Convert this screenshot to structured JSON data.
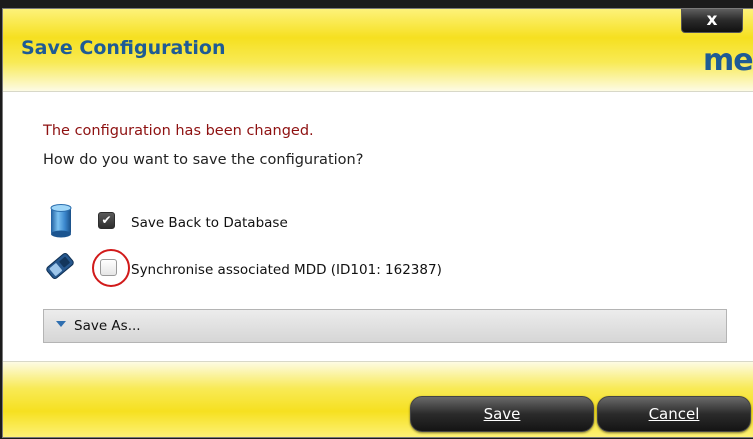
{
  "dialog": {
    "title": "Save Configuration",
    "close_label": "x",
    "logo_text": "mei"
  },
  "message": {
    "changed": "The configuration has been changed.",
    "question": "How do you want to save the configuration?"
  },
  "options": [
    {
      "label": "Save Back to Database",
      "checked": true,
      "icon": "database-icon"
    },
    {
      "label": "Synchronise associated MDD (ID101: 162387)",
      "checked": false,
      "icon": "mdd-device-icon"
    }
  ],
  "save_as": {
    "label": "Save As..."
  },
  "buttons": {
    "save_label": "Save",
    "save_mnemonic": "S",
    "cancel_label": "Cancel",
    "cancel_mnemonic": "C"
  },
  "colors": {
    "title": "#1e5b95",
    "warning_text": "#8e1111",
    "header_yellow": "#f6e020",
    "highlight_circle": "#d11a1a"
  }
}
